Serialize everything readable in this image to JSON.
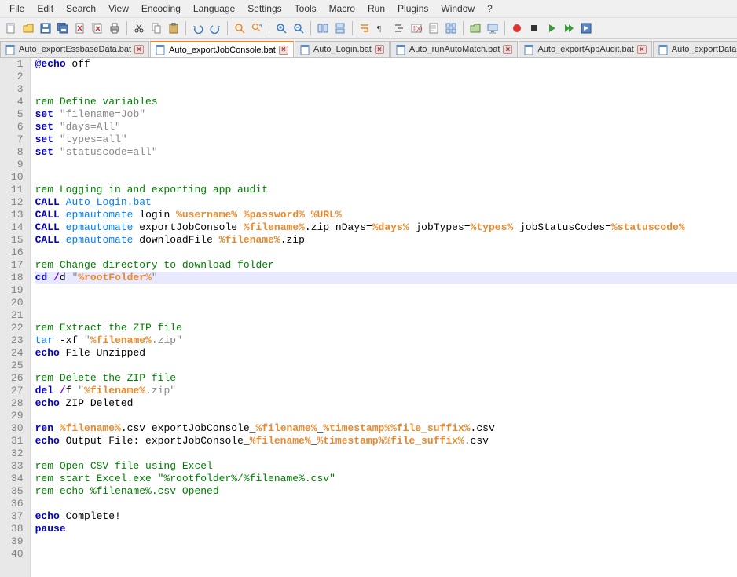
{
  "menu": [
    "File",
    "Edit",
    "Search",
    "View",
    "Encoding",
    "Language",
    "Settings",
    "Tools",
    "Macro",
    "Run",
    "Plugins",
    "Window",
    "?"
  ],
  "toolbar_icons": [
    "new-file-icon",
    "open-icon",
    "save-icon",
    "save-all-icon",
    "close-icon",
    "close-all-icon",
    "print-icon",
    "|",
    "cut-icon",
    "copy-icon",
    "paste-icon",
    "|",
    "undo-icon",
    "redo-icon",
    "|",
    "find-icon",
    "replace-icon",
    "|",
    "zoom-in-icon",
    "zoom-out-icon",
    "|",
    "sync-v-icon",
    "sync-h-icon",
    "|",
    "wrap-icon",
    "all-chars-icon",
    "indent-guide-icon",
    "function-list-icon",
    "doc-map-icon",
    "doc-list-icon",
    "|",
    "folder-workspace-icon",
    "monitor-icon",
    "|",
    "record-icon",
    "stop-icon",
    "play-icon",
    "play-multi-icon",
    "save-macro-icon"
  ],
  "tabs": [
    {
      "label": "Auto_exportEssbaseData.bat",
      "active": false
    },
    {
      "label": "Auto_exportJobConsole.bat",
      "active": true
    },
    {
      "label": "Auto_Login.bat",
      "active": false
    },
    {
      "label": "Auto_runAutoMatch.bat",
      "active": false
    },
    {
      "label": "Auto_exportAppAudit.bat",
      "active": false
    },
    {
      "label": "Auto_exportData.bat",
      "active": false
    },
    {
      "label": "A",
      "active": false,
      "truncated": true
    }
  ],
  "line_count": 40,
  "highlighted_line": 18,
  "code": {
    "lines": [
      {
        "n": 1,
        "t": [
          [
            "kw",
            "@echo"
          ],
          [
            "",
            " off"
          ]
        ]
      },
      {
        "n": 2,
        "t": []
      },
      {
        "n": 3,
        "t": []
      },
      {
        "n": 4,
        "t": [
          [
            "comment",
            "rem Define variables"
          ]
        ]
      },
      {
        "n": 5,
        "t": [
          [
            "kw",
            "set"
          ],
          [
            "",
            " "
          ],
          [
            "str",
            "\"filename=Job\""
          ]
        ]
      },
      {
        "n": 6,
        "t": [
          [
            "kw",
            "set"
          ],
          [
            "",
            " "
          ],
          [
            "str",
            "\"days=All\""
          ]
        ]
      },
      {
        "n": 7,
        "t": [
          [
            "kw",
            "set"
          ],
          [
            "",
            " "
          ],
          [
            "str",
            "\"types=all\""
          ]
        ]
      },
      {
        "n": 8,
        "t": [
          [
            "kw",
            "set"
          ],
          [
            "",
            " "
          ],
          [
            "str",
            "\"statuscode=all\""
          ]
        ]
      },
      {
        "n": 9,
        "t": []
      },
      {
        "n": 10,
        "t": []
      },
      {
        "n": 11,
        "t": [
          [
            "comment",
            "rem Logging in and exporting app audit"
          ]
        ]
      },
      {
        "n": 12,
        "t": [
          [
            "kw",
            "CALL"
          ],
          [
            "",
            " "
          ],
          [
            "ext",
            "Auto_Login.bat"
          ]
        ]
      },
      {
        "n": 13,
        "t": [
          [
            "kw",
            "CALL"
          ],
          [
            "",
            " "
          ],
          [
            "ext",
            "epmautomate"
          ],
          [
            "",
            " login "
          ],
          [
            "var",
            "%username%"
          ],
          [
            "",
            " "
          ],
          [
            "var",
            "%password%"
          ],
          [
            "",
            " "
          ],
          [
            "var",
            "%URL%"
          ]
        ]
      },
      {
        "n": 14,
        "t": [
          [
            "kw",
            "CALL"
          ],
          [
            "",
            " "
          ],
          [
            "ext",
            "epmautomate"
          ],
          [
            "",
            " exportJobConsole "
          ],
          [
            "var",
            "%filename%"
          ],
          [
            "",
            ".zip nDays="
          ],
          [
            "var",
            "%days%"
          ],
          [
            "",
            " jobTypes="
          ],
          [
            "var",
            "%types%"
          ],
          [
            "",
            " jobStatusCodes="
          ],
          [
            "var",
            "%statuscode%"
          ]
        ]
      },
      {
        "n": 15,
        "t": [
          [
            "kw",
            "CALL"
          ],
          [
            "",
            " "
          ],
          [
            "ext",
            "epmautomate"
          ],
          [
            "",
            " downloadFile "
          ],
          [
            "var",
            "%filename%"
          ],
          [
            "",
            ".zip"
          ]
        ]
      },
      {
        "n": 16,
        "t": []
      },
      {
        "n": 17,
        "t": [
          [
            "comment",
            "rem Change directory to download folder"
          ]
        ]
      },
      {
        "n": 18,
        "t": [
          [
            "kw",
            "cd"
          ],
          [
            "",
            " "
          ],
          [
            "op",
            "/"
          ],
          [
            "",
            "d "
          ],
          [
            "str",
            "\""
          ],
          [
            "var",
            "%rootFolder%"
          ],
          [
            "str",
            "\""
          ]
        ]
      },
      {
        "n": 19,
        "t": []
      },
      {
        "n": 20,
        "t": []
      },
      {
        "n": 21,
        "t": []
      },
      {
        "n": 22,
        "t": [
          [
            "comment",
            "rem Extract the ZIP file"
          ]
        ]
      },
      {
        "n": 23,
        "t": [
          [
            "ext",
            "tar"
          ],
          [
            "",
            " -xf "
          ],
          [
            "str",
            "\""
          ],
          [
            "var",
            "%filename%"
          ],
          [
            "str",
            ".zip\""
          ]
        ]
      },
      {
        "n": 24,
        "t": [
          [
            "kw",
            "echo"
          ],
          [
            "",
            " File Unzipped"
          ]
        ]
      },
      {
        "n": 25,
        "t": []
      },
      {
        "n": 26,
        "t": [
          [
            "comment",
            "rem Delete the ZIP file"
          ]
        ]
      },
      {
        "n": 27,
        "t": [
          [
            "kw",
            "del"
          ],
          [
            "",
            " "
          ],
          [
            "op",
            "/"
          ],
          [
            "",
            "f "
          ],
          [
            "str",
            "\""
          ],
          [
            "var",
            "%filename%"
          ],
          [
            "str",
            ".zip\""
          ]
        ]
      },
      {
        "n": 28,
        "t": [
          [
            "kw",
            "echo"
          ],
          [
            "",
            " ZIP Deleted"
          ]
        ]
      },
      {
        "n": 29,
        "t": []
      },
      {
        "n": 30,
        "t": [
          [
            "kw",
            "ren"
          ],
          [
            "",
            " "
          ],
          [
            "var",
            "%filename%"
          ],
          [
            "",
            ".csv exportJobConsole_"
          ],
          [
            "var",
            "%filename%"
          ],
          [
            "",
            "_"
          ],
          [
            "var",
            "%timestamp%%file_suffix%"
          ],
          [
            "",
            ".csv"
          ]
        ]
      },
      {
        "n": 31,
        "t": [
          [
            "kw",
            "echo"
          ],
          [
            "",
            " Output File: exportJobConsole_"
          ],
          [
            "var",
            "%filename%"
          ],
          [
            "",
            "_"
          ],
          [
            "var",
            "%timestamp%%file_suffix%"
          ],
          [
            "",
            ".csv"
          ]
        ]
      },
      {
        "n": 32,
        "t": []
      },
      {
        "n": 33,
        "t": [
          [
            "comment",
            "rem Open CSV file using Excel"
          ]
        ]
      },
      {
        "n": 34,
        "t": [
          [
            "comment",
            "rem start Excel.exe \"%rootfolder%/%filename%.csv\""
          ]
        ]
      },
      {
        "n": 35,
        "t": [
          [
            "comment",
            "rem echo %filename%.csv Opened"
          ]
        ]
      },
      {
        "n": 36,
        "t": []
      },
      {
        "n": 37,
        "t": [
          [
            "kw",
            "echo"
          ],
          [
            "",
            " Complete!"
          ]
        ]
      },
      {
        "n": 38,
        "t": [
          [
            "kw",
            "pause"
          ]
        ]
      },
      {
        "n": 39,
        "t": []
      },
      {
        "n": 40,
        "t": []
      }
    ]
  }
}
